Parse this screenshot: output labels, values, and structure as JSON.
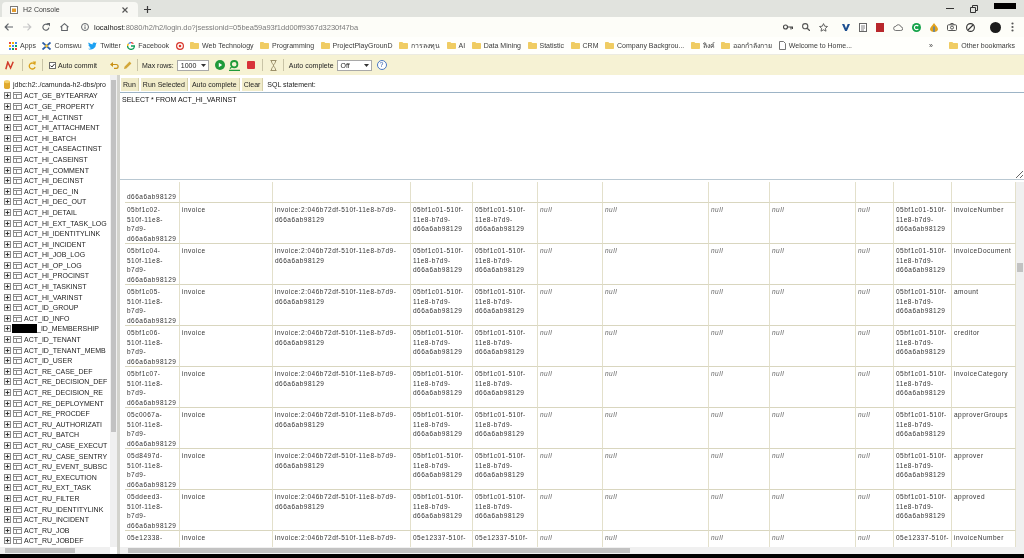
{
  "browser": {
    "tabs": [
      {
        "title": "H2 Console",
        "selected": true
      }
    ],
    "navigation": {
      "back_disabled": false,
      "forward_disabled": true
    },
    "address": {
      "host": "localhost",
      "rest": ":8080/h2/h2/login.do?jsessionid=05bea59a93f1dd00ff9367d3230f47ba"
    },
    "bookmarks": [
      {
        "kind": "apps",
        "label": "Apps"
      },
      {
        "kind": "cross",
        "label": "Comswu"
      },
      {
        "kind": "bird",
        "label": "Twitter"
      },
      {
        "kind": "letter_ring",
        "label": "Facebook"
      },
      {
        "kind": "ring"
      },
      {
        "kind": "folder",
        "label": "Web Technology"
      },
      {
        "kind": "folder",
        "label": "Programming"
      },
      {
        "kind": "folder",
        "label": "ProjectPlayGrounD"
      },
      {
        "kind": "folder",
        "label": "การลงทุน"
      },
      {
        "kind": "folder",
        "label": "AI"
      },
      {
        "kind": "folder",
        "label": "Data Mining"
      },
      {
        "kind": "folder",
        "label": "Statistic"
      },
      {
        "kind": "folder",
        "label": "CRM"
      },
      {
        "kind": "folder",
        "label": "Company Backgrou..."
      },
      {
        "kind": "folder",
        "label": "ลิงค์"
      },
      {
        "kind": "folder",
        "label": "ออกกำลังกาย"
      },
      {
        "kind": "page",
        "label": "Welcome to Home..."
      }
    ],
    "bookmarks_overflow": "»",
    "other_bookmarks": {
      "kind": "folder",
      "label": "Other bookmarks"
    }
  },
  "h2": {
    "toolbar": {
      "auto_commit": {
        "label": "Auto commit",
        "checked": true
      },
      "max_rows": {
        "label": "Max rows:",
        "value": "1000"
      },
      "auto_complete": {
        "label": "Auto complete",
        "value": "Off"
      },
      "help": "?"
    },
    "connection": "jdbc:h2:./camunda-h2-dbs/pro",
    "tables": [
      {
        "name": "ACT_GE_BYTEARRAY",
        "kind": "table",
        "expanded": false
      },
      {
        "name": "ACT_GE_PROPERTY",
        "kind": "table",
        "expanded": false
      },
      {
        "name": "ACT_HI_ACTINST",
        "kind": "table",
        "expanded": false
      },
      {
        "name": "ACT_HI_ATTACHMENT",
        "kind": "table",
        "expanded": false
      },
      {
        "name": "ACT_HI_BATCH",
        "kind": "table",
        "expanded": false
      },
      {
        "name": "ACT_HI_CASEACTINST",
        "kind": "table",
        "expanded": false
      },
      {
        "name": "ACT_HI_CASEINST",
        "kind": "table",
        "expanded": false
      },
      {
        "name": "ACT_HI_COMMENT",
        "kind": "table",
        "expanded": false
      },
      {
        "name": "ACT_HI_DECINST",
        "kind": "table",
        "expanded": false
      },
      {
        "name": "ACT_HI_DEC_IN",
        "kind": "table",
        "expanded": false
      },
      {
        "name": "ACT_HI_DEC_OUT",
        "kind": "table",
        "expanded": false
      },
      {
        "name": "ACT_HI_DETAIL",
        "kind": "table",
        "expanded": false
      },
      {
        "name": "ACT_HI_EXT_TASK_LOG",
        "kind": "table",
        "expanded": false
      },
      {
        "name": "ACT_HI_IDENTITYLINK",
        "kind": "table",
        "expanded": false
      },
      {
        "name": "ACT_HI_INCIDENT",
        "kind": "table",
        "expanded": false
      },
      {
        "name": "ACT_HI_JOB_LOG",
        "kind": "table",
        "expanded": false
      },
      {
        "name": "ACT_HI_OP_LOG",
        "kind": "table",
        "expanded": false
      },
      {
        "name": "ACT_HI_PROCINST",
        "kind": "table",
        "expanded": false
      },
      {
        "name": "ACT_HI_TASKINST",
        "kind": "table",
        "expanded": false
      },
      {
        "name": "ACT_HI_VARINST",
        "kind": "table",
        "expanded": false
      },
      {
        "name": "ACT_ID_GROUP",
        "kind": "table",
        "expanded": false
      },
      {
        "name": "ACT_ID_INFO",
        "kind": "table",
        "expanded": false
      },
      {
        "name": "_ID_MEMBERSHIP",
        "kind": "redacted",
        "expanded": false
      },
      {
        "name": "ACT_ID_TENANT",
        "kind": "table",
        "expanded": false
      },
      {
        "name": "ACT_ID_TENANT_MEMB",
        "kind": "table",
        "expanded": false
      },
      {
        "name": "ACT_ID_USER",
        "kind": "table",
        "expanded": false
      },
      {
        "name": "ACT_RE_CASE_DEF",
        "kind": "table",
        "expanded": false
      },
      {
        "name": "ACT_RE_DECISION_DEF",
        "kind": "table",
        "expanded": false
      },
      {
        "name": "ACT_RE_DECISION_RE",
        "kind": "table",
        "expanded": false
      },
      {
        "name": "ACT_RE_DEPLOYMENT",
        "kind": "table",
        "expanded": false
      },
      {
        "name": "ACT_RE_PROCDEF",
        "kind": "table",
        "expanded": false
      },
      {
        "name": "ACT_RU_AUTHORIZATI",
        "kind": "table",
        "expanded": false
      },
      {
        "name": "ACT_RU_BATCH",
        "kind": "table",
        "expanded": false
      },
      {
        "name": "ACT_RU_CASE_EXECUT",
        "kind": "table",
        "expanded": false
      },
      {
        "name": "ACT_RU_CASE_SENTRY",
        "kind": "table",
        "expanded": false
      },
      {
        "name": "ACT_RU_EVENT_SUBSC",
        "kind": "table",
        "expanded": false
      },
      {
        "name": "ACT_RU_EXECUTION",
        "kind": "table",
        "expanded": false
      },
      {
        "name": "ACT_RU_EXT_TASK",
        "kind": "table",
        "expanded": false
      },
      {
        "name": "ACT_RU_FILTER",
        "kind": "table",
        "expanded": false
      },
      {
        "name": "ACT_RU_IDENTITYLINK",
        "kind": "table",
        "expanded": false
      },
      {
        "name": "ACT_RU_INCIDENT",
        "kind": "table",
        "expanded": false
      },
      {
        "name": "ACT_RU_JOB",
        "kind": "table",
        "expanded": false
      },
      {
        "name": "ACT_RU_JOBDEF",
        "kind": "table",
        "expanded": false
      }
    ],
    "query": {
      "buttons": [
        "Run",
        "Run Selected",
        "Auto complete",
        "Clear"
      ],
      "label": "SQL statement:",
      "sql": "SELECT * FROM ACT_HI_VARINST"
    },
    "results": {
      "rows": [
        {
          "kind": "tail",
          "cells": [
            {
              "text": "d66a6ab98129",
              "sql_null": false
            }
          ]
        },
        {
          "kind": "full",
          "cells": [
            {
              "text": "05bf1c02-510f-11e8-b7d9-d66a6ab98129",
              "sql_null": false
            },
            {
              "text": "invoice",
              "sql_null": false
            },
            {
              "text": "invoice:2:046b72df-510f-11e8-b7d9-d66a6ab98129",
              "sql_null": false
            },
            {
              "text": "05bf1c01-510f-11e8-b7d9-d66a6ab98129",
              "sql_null": false
            },
            {
              "text": "05bf1c01-510f-11e8-b7d9-d66a6ab98129",
              "sql_null": false
            },
            {
              "text": "null",
              "sql_null": true
            },
            {
              "text": "null",
              "sql_null": true
            },
            {
              "text": "null",
              "sql_null": true
            },
            {
              "text": "null",
              "sql_null": true
            },
            {
              "text": "null",
              "sql_null": true
            },
            {
              "text": "05bf1c01-510f-11e8-b7d9-d66a6ab98129",
              "sql_null": false
            },
            {
              "text": "invoiceNumber",
              "sql_null": false
            }
          ]
        },
        {
          "kind": "full",
          "cells": [
            {
              "text": "05bf1c04-510f-11e8-b7d9-d66a6ab98129",
              "sql_null": false
            },
            {
              "text": "invoice",
              "sql_null": false
            },
            {
              "text": "invoice:2:046b72df-510f-11e8-b7d9-d66a6ab98129",
              "sql_null": false
            },
            {
              "text": "05bf1c01-510f-11e8-b7d9-d66a6ab98129",
              "sql_null": false
            },
            {
              "text": "05bf1c01-510f-11e8-b7d9-d66a6ab98129",
              "sql_null": false
            },
            {
              "text": "null",
              "sql_null": true
            },
            {
              "text": "null",
              "sql_null": true
            },
            {
              "text": "null",
              "sql_null": true
            },
            {
              "text": "null",
              "sql_null": true
            },
            {
              "text": "null",
              "sql_null": true
            },
            {
              "text": "05bf1c01-510f-11e8-b7d9-d66a6ab98129",
              "sql_null": false
            },
            {
              "text": "invoiceDocument",
              "sql_null": false
            }
          ]
        },
        {
          "kind": "full",
          "cells": [
            {
              "text": "05bf1c05-510f-11e8-b7d9-d66a6ab98129",
              "sql_null": false
            },
            {
              "text": "invoice",
              "sql_null": false
            },
            {
              "text": "invoice:2:046b72df-510f-11e8-b7d9-d66a6ab98129",
              "sql_null": false
            },
            {
              "text": "05bf1c01-510f-11e8-b7d9-d66a6ab98129",
              "sql_null": false
            },
            {
              "text": "05bf1c01-510f-11e8-b7d9-d66a6ab98129",
              "sql_null": false
            },
            {
              "text": "null",
              "sql_null": true
            },
            {
              "text": "null",
              "sql_null": true
            },
            {
              "text": "null",
              "sql_null": true
            },
            {
              "text": "null",
              "sql_null": true
            },
            {
              "text": "null",
              "sql_null": true
            },
            {
              "text": "05bf1c01-510f-11e8-b7d9-d66a6ab98129",
              "sql_null": false
            },
            {
              "text": "amount",
              "sql_null": false
            }
          ]
        },
        {
          "kind": "full",
          "cells": [
            {
              "text": "05bf1c06-510f-11e8-b7d9-d66a6ab98129",
              "sql_null": false
            },
            {
              "text": "invoice",
              "sql_null": false
            },
            {
              "text": "invoice:2:046b72df-510f-11e8-b7d9-d66a6ab98129",
              "sql_null": false
            },
            {
              "text": "05bf1c01-510f-11e8-b7d9-d66a6ab98129",
              "sql_null": false
            },
            {
              "text": "05bf1c01-510f-11e8-b7d9-d66a6ab98129",
              "sql_null": false
            },
            {
              "text": "null",
              "sql_null": true
            },
            {
              "text": "null",
              "sql_null": true
            },
            {
              "text": "null",
              "sql_null": true
            },
            {
              "text": "null",
              "sql_null": true
            },
            {
              "text": "null",
              "sql_null": true
            },
            {
              "text": "05bf1c01-510f-11e8-b7d9-d66a6ab98129",
              "sql_null": false
            },
            {
              "text": "creditor",
              "sql_null": false
            }
          ]
        },
        {
          "kind": "full",
          "cells": [
            {
              "text": "05bf1c07-510f-11e8-b7d9-d66a6ab98129",
              "sql_null": false
            },
            {
              "text": "invoice",
              "sql_null": false
            },
            {
              "text": "invoice:2:046b72df-510f-11e8-b7d9-d66a6ab98129",
              "sql_null": false
            },
            {
              "text": "05bf1c01-510f-11e8-b7d9-d66a6ab98129",
              "sql_null": false
            },
            {
              "text": "05bf1c01-510f-11e8-b7d9-d66a6ab98129",
              "sql_null": false
            },
            {
              "text": "null",
              "sql_null": true
            },
            {
              "text": "null",
              "sql_null": true
            },
            {
              "text": "null",
              "sql_null": true
            },
            {
              "text": "null",
              "sql_null": true
            },
            {
              "text": "null",
              "sql_null": true
            },
            {
              "text": "05bf1c01-510f-11e8-b7d9-d66a6ab98129",
              "sql_null": false
            },
            {
              "text": "invoiceCategory",
              "sql_null": false
            }
          ]
        },
        {
          "kind": "full",
          "cells": [
            {
              "text": "05c0067a-510f-11e8-b7d9-d66a6ab98129",
              "sql_null": false
            },
            {
              "text": "invoice",
              "sql_null": false
            },
            {
              "text": "invoice:2:046b72df-510f-11e8-b7d9-d66a6ab98129",
              "sql_null": false
            },
            {
              "text": "05bf1c01-510f-11e8-b7d9-d66a6ab98129",
              "sql_null": false
            },
            {
              "text": "05bf1c01-510f-11e8-b7d9-d66a6ab98129",
              "sql_null": false
            },
            {
              "text": "null",
              "sql_null": true
            },
            {
              "text": "null",
              "sql_null": true
            },
            {
              "text": "null",
              "sql_null": true
            },
            {
              "text": "null",
              "sql_null": true
            },
            {
              "text": "null",
              "sql_null": true
            },
            {
              "text": "05bf1c01-510f-11e8-b7d9-d66a6ab98129",
              "sql_null": false
            },
            {
              "text": "approverGroups",
              "sql_null": false
            }
          ]
        },
        {
          "kind": "full",
          "cells": [
            {
              "text": "05d8497d-510f-11e8-b7d9-d66a6ab98129",
              "sql_null": false
            },
            {
              "text": "invoice",
              "sql_null": false
            },
            {
              "text": "invoice:2:046b72df-510f-11e8-b7d9-d66a6ab98129",
              "sql_null": false
            },
            {
              "text": "05bf1c01-510f-11e8-b7d9-d66a6ab98129",
              "sql_null": false
            },
            {
              "text": "05bf1c01-510f-11e8-b7d9-d66a6ab98129",
              "sql_null": false
            },
            {
              "text": "null",
              "sql_null": true
            },
            {
              "text": "null",
              "sql_null": true
            },
            {
              "text": "null",
              "sql_null": true
            },
            {
              "text": "null",
              "sql_null": true
            },
            {
              "text": "null",
              "sql_null": true
            },
            {
              "text": "05bf1c01-510f-11e8-b7d9-d66a6ab98129",
              "sql_null": false
            },
            {
              "text": "approver",
              "sql_null": false
            }
          ]
        },
        {
          "kind": "full",
          "cells": [
            {
              "text": "05ddeed3-510f-11e8-b7d9-d66a6ab98129",
              "sql_null": false
            },
            {
              "text": "invoice",
              "sql_null": false
            },
            {
              "text": "invoice:2:046b72df-510f-11e8-b7d9-d66a6ab98129",
              "sql_null": false
            },
            {
              "text": "05bf1c01-510f-11e8-b7d9-d66a6ab98129",
              "sql_null": false
            },
            {
              "text": "05bf1c01-510f-11e8-b7d9-d66a6ab98129",
              "sql_null": false
            },
            {
              "text": "null",
              "sql_null": true
            },
            {
              "text": "null",
              "sql_null": true
            },
            {
              "text": "null",
              "sql_null": true
            },
            {
              "text": "null",
              "sql_null": true
            },
            {
              "text": "null",
              "sql_null": true
            },
            {
              "text": "05bf1c01-510f-11e8-b7d9-d66a6ab98129",
              "sql_null": false
            },
            {
              "text": "approved",
              "sql_null": false
            }
          ]
        },
        {
          "kind": "head",
          "cells": [
            {
              "text": "05e12338-",
              "sql_null": false
            },
            {
              "text": "invoice",
              "sql_null": false
            },
            {
              "text": "invoice:2:046b72df-510f-11e8-b7d9-",
              "sql_null": false
            },
            {
              "text": "05e12337-510f-",
              "sql_null": false
            },
            {
              "text": "05e12337-510f-",
              "sql_null": false
            },
            {
              "text": "null",
              "sql_null": true
            },
            {
              "text": "null",
              "sql_null": true
            },
            {
              "text": "null",
              "sql_null": true
            },
            {
              "text": "null",
              "sql_null": true
            },
            {
              "text": "null",
              "sql_null": true
            },
            {
              "text": "05e12337-510f-",
              "sql_null": false
            },
            {
              "text": "invoiceNumber",
              "sql_null": false
            }
          ]
        }
      ]
    }
  }
}
